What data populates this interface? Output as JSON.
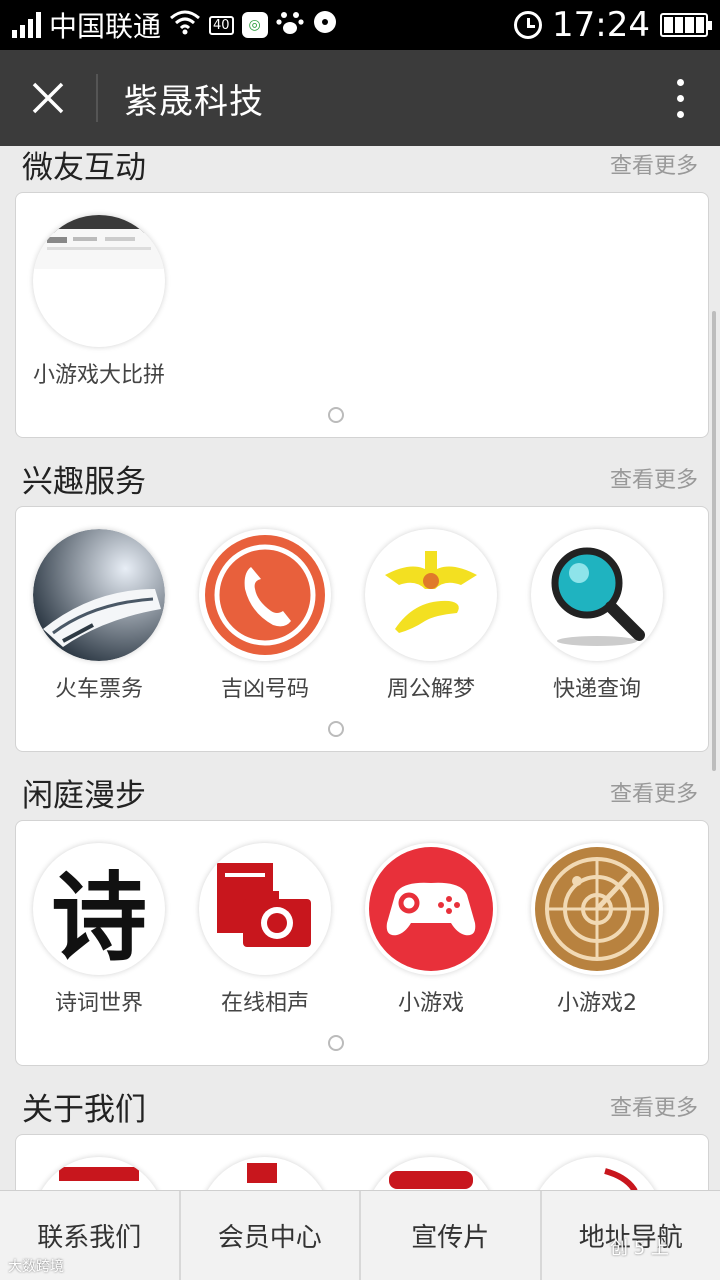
{
  "status_bar": {
    "carrier": "中国联通",
    "network_badge": "40",
    "time": "17:24"
  },
  "nav": {
    "title": "紫晟科技"
  },
  "sections": [
    {
      "title": "微友互动",
      "more": "查看更多",
      "items": [
        {
          "label": "小游戏大比拼",
          "icon": "screenshot-thumbnail-icon"
        }
      ]
    },
    {
      "title": "兴趣服务",
      "more": "查看更多",
      "items": [
        {
          "label": "火车票务",
          "icon": "train-icon"
        },
        {
          "label": "吉凶号码",
          "icon": "phone-icon"
        },
        {
          "label": "周公解梦",
          "icon": "dream-hand-icon"
        },
        {
          "label": "快递查询",
          "icon": "magnifier-icon"
        }
      ]
    },
    {
      "title": "闲庭漫步",
      "more": "查看更多",
      "items": [
        {
          "label": "诗词世界",
          "icon": "poem-character-icon",
          "glyph": "诗"
        },
        {
          "label": "在线相声",
          "icon": "camera-icon"
        },
        {
          "label": "小游戏",
          "icon": "gamepad-icon"
        },
        {
          "label": "小游戏2",
          "icon": "radar-icon"
        }
      ]
    },
    {
      "title": "关于我们",
      "more": "查看更多"
    }
  ],
  "tabs": [
    "联系我们",
    "会员中心",
    "宣传片",
    "地址导航"
  ],
  "watermark": {
    "left": "大数跨境",
    "right": "创 5 上"
  },
  "colors": {
    "navbar": "#3b3b3b",
    "statusbar": "#000000",
    "background": "#ebebeb"
  }
}
